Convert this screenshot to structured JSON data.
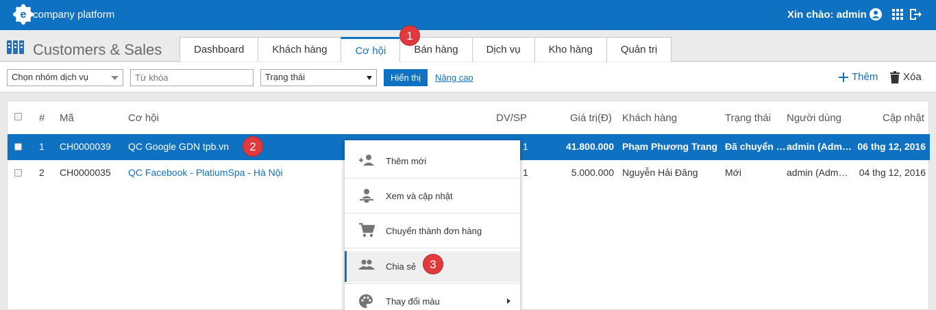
{
  "app": {
    "brand": "company platform",
    "greeting": "Xin chào: admin"
  },
  "module": {
    "title": "Customers & Sales",
    "tabs": [
      {
        "label": "Dashboard"
      },
      {
        "label": "Khách hàng"
      },
      {
        "label": "Cơ hội"
      },
      {
        "label": "Bán hàng"
      },
      {
        "label": "Dịch vụ"
      },
      {
        "label": "Kho hàng"
      },
      {
        "label": "Quản trị"
      }
    ],
    "active_tab": "Cơ hội"
  },
  "filters": {
    "group_select": "Chọn nhóm dịch vụ",
    "keyword_placeholder": "Từ khóa",
    "status_select": "Trạng thái",
    "show_button": "Hiển thị",
    "advanced_link": "Nâng cao",
    "add_label": "Thêm",
    "delete_label": "Xóa"
  },
  "table": {
    "headers": {
      "num": "#",
      "code": "Mã",
      "name": "Cơ hội",
      "dvsp": "DV/SP",
      "value": "Giá trị(Đ)",
      "customer": "Khách hàng",
      "status": "Trạng thái",
      "user": "Người dùng",
      "updated": "Cập nhật"
    },
    "rows": [
      {
        "num": "1",
        "code": "CH0000039",
        "name": "QC Google GDN tpb.vn",
        "dvsp": "1",
        "value": "41.800.000",
        "customer": "Phạm Phương Trang",
        "status": "Đã chuyển …",
        "user": "admin (Adm…",
        "updated": "06 thg 12, 2016"
      },
      {
        "num": "2",
        "code": "CH0000035",
        "name": "QC Facebook - PlatiumSpa - Hà Nội",
        "dvsp": "1",
        "value": "5.000.000",
        "customer": "Nguyễn Hải Đăng",
        "status": "Mới",
        "user": "admin (Adm…",
        "updated": "04 thg 12, 2016"
      }
    ]
  },
  "context_menu": {
    "items": [
      {
        "label": "Thêm mới",
        "icon": "add-person-icon"
      },
      {
        "label": "Xem và cập nhật",
        "icon": "view-person-icon"
      },
      {
        "label": "Chuyển thành đơn hàng",
        "icon": "cart-icon"
      },
      {
        "label": "Chia sẻ",
        "icon": "people-icon"
      },
      {
        "label": "Thay đổi màu",
        "icon": "palette-icon"
      }
    ]
  },
  "badges": [
    "1",
    "2",
    "3"
  ],
  "colors": {
    "primary": "#0f71c2",
    "badge": "#e0393e"
  }
}
